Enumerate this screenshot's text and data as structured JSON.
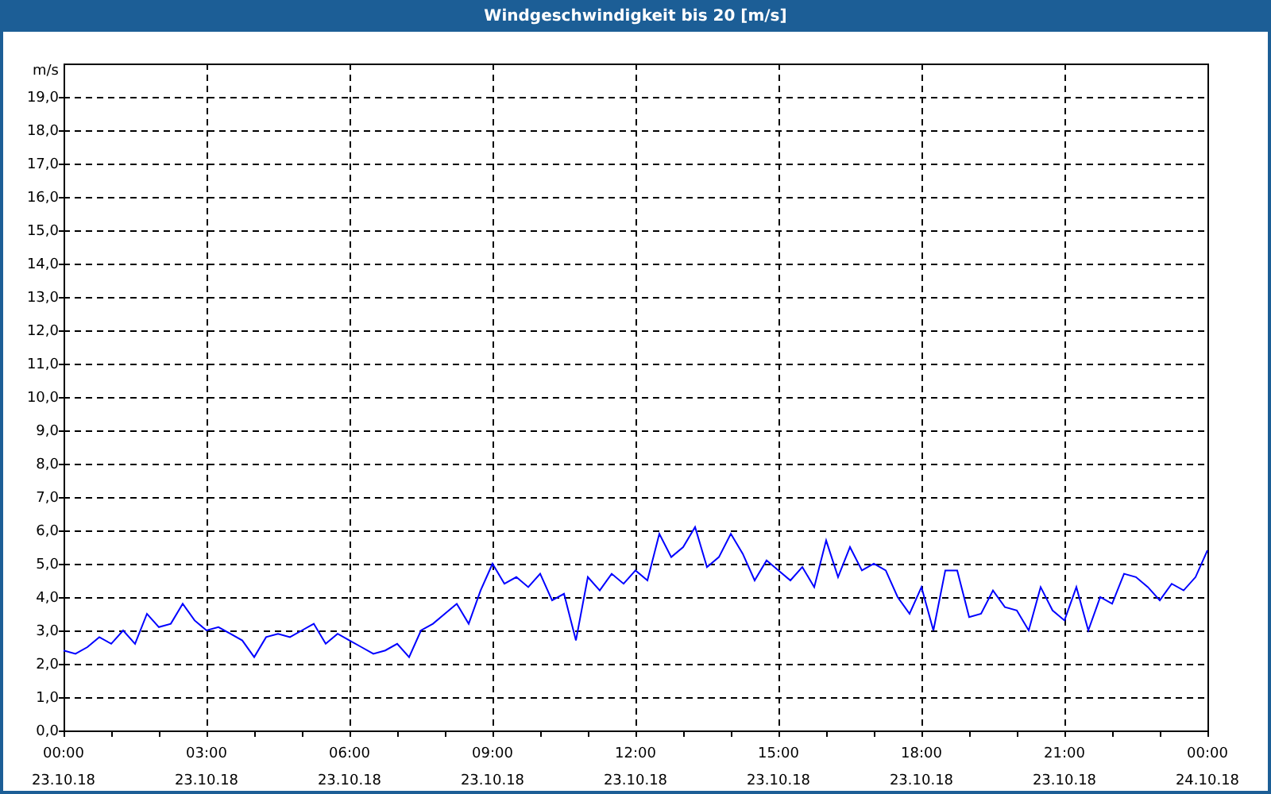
{
  "window": {
    "title": "Windgeschwindigkeit bis 20 [m/s]"
  },
  "chart_data": {
    "type": "line",
    "grid": true,
    "ylabel": "m/s",
    "ylim": [
      0,
      20
    ],
    "categories": [
      "00:00\n23.10.18",
      null,
      null,
      null,
      null,
      null,
      null,
      null,
      null,
      null,
      null,
      null,
      "03:00\n23.10.18",
      null,
      null,
      null,
      null,
      null,
      null,
      null,
      null,
      null,
      null,
      null,
      "06:00\n23.10.18",
      null,
      null,
      null,
      null,
      null,
      null,
      null,
      null,
      null,
      null,
      null,
      "09:00\n23.10.18",
      null,
      null,
      null,
      null,
      null,
      null,
      null,
      null,
      null,
      null,
      null,
      "12:00\n23.10.18",
      null,
      null,
      null,
      null,
      null,
      null,
      null,
      null,
      null,
      null,
      null,
      "15:00\n23.10.18",
      null,
      null,
      null,
      null,
      null,
      null,
      null,
      null,
      null,
      null,
      null,
      "18:00\n23.10.18",
      null,
      null,
      null,
      null,
      null,
      null,
      null,
      null,
      null,
      null,
      null,
      "21:00\n23.10.18",
      null,
      null,
      null,
      null,
      null,
      null,
      null,
      null,
      null,
      null,
      null,
      "00:00\n24.10.18"
    ],
    "yticks": [
      {
        "value": 0,
        "label": "0,0"
      },
      {
        "value": 1,
        "label": "1,0"
      },
      {
        "value": 2,
        "label": "2,0"
      },
      {
        "value": 3,
        "label": "3,0"
      },
      {
        "value": 4,
        "label": "4,0"
      },
      {
        "value": 5,
        "label": "5,0"
      },
      {
        "value": 6,
        "label": "6,0"
      },
      {
        "value": 7,
        "label": "7,0"
      },
      {
        "value": 8,
        "label": "8,0"
      },
      {
        "value": 9,
        "label": "9,0"
      },
      {
        "value": 10,
        "label": "10,0"
      },
      {
        "value": 11,
        "label": "11,0"
      },
      {
        "value": 12,
        "label": "12,0"
      },
      {
        "value": 13,
        "label": "13,0"
      },
      {
        "value": 14,
        "label": "14,0"
      },
      {
        "value": 15,
        "label": "15,0"
      },
      {
        "value": 16,
        "label": "16,0"
      },
      {
        "value": 17,
        "label": "17,0"
      },
      {
        "value": 18,
        "label": "18,0"
      },
      {
        "value": 19,
        "label": "19,0"
      }
    ],
    "series": [
      {
        "color": "#0000ff",
        "values": [
          2.4,
          2.3,
          2.5,
          2.8,
          2.6,
          3.0,
          2.6,
          3.5,
          3.1,
          3.2,
          3.8,
          3.3,
          3.0,
          3.1,
          2.9,
          2.7,
          2.2,
          2.8,
          2.9,
          2.8,
          3.0,
          3.2,
          2.6,
          2.9,
          2.7,
          2.5,
          2.3,
          2.4,
          2.6,
          2.2,
          3.0,
          3.2,
          3.5,
          3.8,
          3.2,
          4.2,
          5.0,
          4.4,
          4.6,
          4.3,
          4.7,
          3.9,
          4.1,
          2.7,
          4.6,
          4.2,
          4.7,
          4.4,
          4.8,
          4.5,
          5.9,
          5.2,
          5.5,
          6.1,
          4.9,
          5.2,
          5.9,
          5.3,
          4.5,
          5.1,
          4.8,
          4.5,
          4.9,
          4.3,
          5.7,
          4.6,
          5.5,
          4.8,
          5.0,
          4.8,
          4.0,
          3.5,
          4.3,
          3.0,
          4.8,
          4.8,
          3.4,
          3.5,
          4.2,
          3.7,
          3.6,
          3.0,
          4.3,
          3.6,
          3.3,
          4.3,
          3.0,
          4.0,
          3.8,
          4.7,
          4.6,
          4.3,
          3.9,
          4.4,
          4.2,
          4.6,
          5.4
        ]
      }
    ]
  }
}
